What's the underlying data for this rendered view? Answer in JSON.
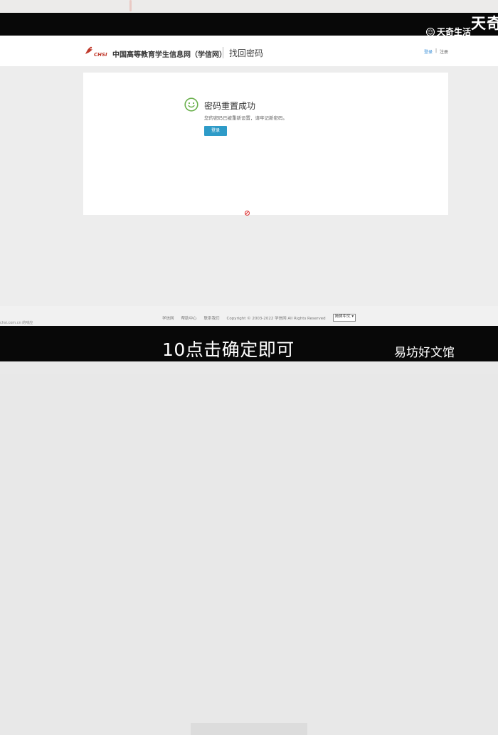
{
  "watermark_top": {
    "icon": "smile-circle-icon",
    "small": "天奇生活",
    "big": "天奇"
  },
  "header": {
    "logo_text": "CHSI",
    "site_name": "中国高等教育学生信息网（学信网）",
    "page_title": "找回密码",
    "nav": {
      "login": "登录",
      "separator": "|",
      "register": "注册"
    }
  },
  "card": {
    "icon": "smiley-icon",
    "title": "密码重置成功",
    "message": "您的密码已被重新设置，请牢记新密码。",
    "button": "登录"
  },
  "footer": {
    "links": [
      "学信网",
      "帮助中心",
      "联系我们"
    ],
    "copyright": "Copyright © 2003-2022 学信网 All Rights Reserved",
    "language": "简体中文"
  },
  "status_text": "chsi.com.cn 的响应",
  "subtitle": "10点击确定即可",
  "watermark_bottom": "易坊好文馆",
  "colors": {
    "button": "#2e9bc8",
    "smiley": "#6ab04c",
    "logo": "#c0392b",
    "bars": "#080808"
  }
}
